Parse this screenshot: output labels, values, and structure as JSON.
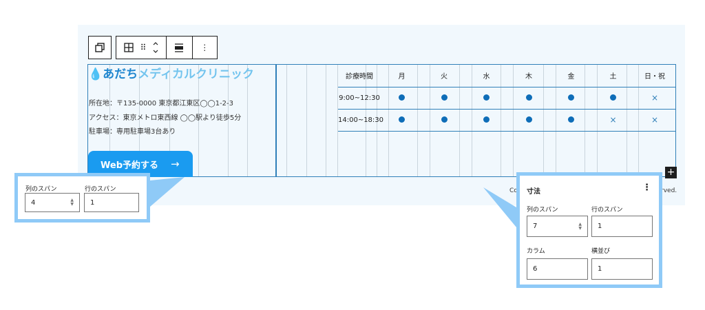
{
  "toolbar": {
    "duplicate_icon": "copy-icon",
    "grid_icon": "grid-icon",
    "drag_icon": "drag-handle-icon",
    "move_icon": "chevron-updown-icon",
    "align_icon": "justify-icon",
    "more_icon": "more-vertical-icon",
    "glyph_drag": "⠿",
    "glyph_more": "⋮"
  },
  "clinic": {
    "drop": "💧",
    "name_dark": "あだち",
    "name_light": "メディカルクリニック",
    "address": "所在地：〒135-0000 東京都江東区◯◯1-2-3",
    "access": "アクセス：東京メトロ東西線 ◯◯駅より徒歩5分",
    "parking": "駐車場：専用駐車場3台あり",
    "web_button": "Web予約する",
    "web_arrow": "→"
  },
  "schedule": {
    "headers": [
      "診療時間",
      "月",
      "火",
      "水",
      "木",
      "金",
      "土",
      "日・祝"
    ],
    "rows": [
      {
        "time": "9:00~12:30",
        "marks": [
          "●",
          "●",
          "●",
          "●",
          "●",
          "●",
          "×"
        ]
      },
      {
        "time": "14:00~18:30",
        "marks": [
          "●",
          "●",
          "●",
          "●",
          "●",
          "×",
          "×"
        ]
      }
    ]
  },
  "footer": {
    "left": "Co",
    "right": "rved."
  },
  "add_button": "+",
  "left_panel": {
    "col_span_label": "列のスパン",
    "row_span_label": "行のスパン",
    "col_span_value": "4",
    "row_span_value": "1"
  },
  "right_panel": {
    "title": "寸法",
    "menu": "⋮",
    "col_span_label": "列のスパン",
    "row_span_label": "行のスパン",
    "col_span_value": "7",
    "row_span_value": "1",
    "columns_label": "カラム",
    "minwidth_label": "横並び",
    "columns_value": "6",
    "minwidth_value": "1"
  },
  "colors": {
    "accent": "#1a9bf0",
    "callout": "#8fcaf7",
    "dot": "#0e6db8",
    "border": "#2f7fb8"
  }
}
